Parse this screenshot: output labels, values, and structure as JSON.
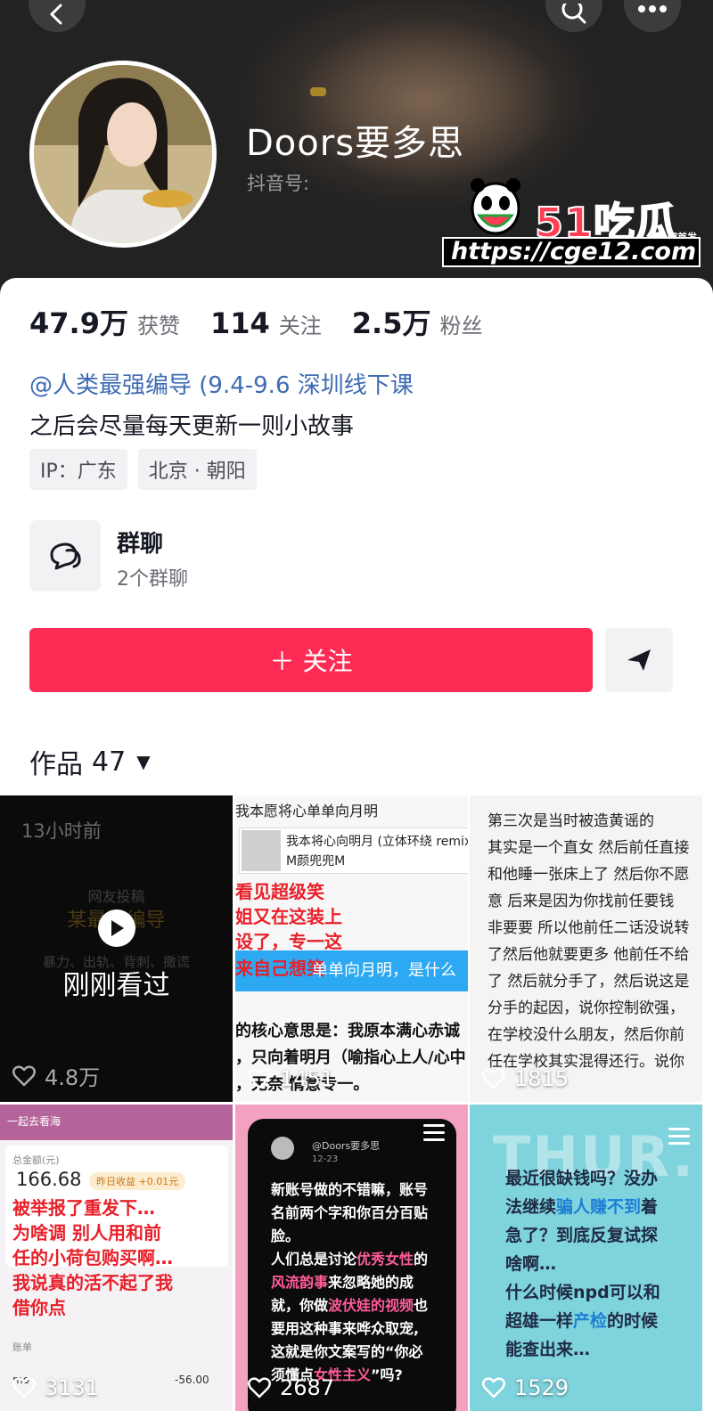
{
  "profile": {
    "nickname": "Doors要多思",
    "douyin_id_label": "抖音号:",
    "stats": [
      {
        "value": "47.9万",
        "label": "获赞"
      },
      {
        "value": "114",
        "label": "关注"
      },
      {
        "value": "2.5万",
        "label": "粉丝"
      }
    ],
    "bio_link": "@人类最强编导 (9.4-9.6 深圳线下课",
    "bio_text": "之后会尽量每天更新一则小故事",
    "tags": [
      "IP：广东",
      "北京 · 朝阳"
    ],
    "group_chat": {
      "title": "群聊",
      "subtitle": "2个群聊"
    },
    "follow_label": "＋ 关注"
  },
  "watermark": {
    "brand": "51吃瓜",
    "tag": "全网首发",
    "url": "https://cge12.com"
  },
  "works": {
    "label": "作品",
    "count": "47"
  },
  "videos": [
    {
      "likes": "4.8万",
      "time": "13小时前",
      "faint_top": "网友投稿",
      "faint_title": "某最强编导",
      "faint_sub": "暴力、出轨、背刺、撒谎",
      "watched": "刚刚看过"
    },
    {
      "likes": "1451",
      "top_caption": "我本愿将心单单向月明",
      "song_line1": "我本将心向明月 (立体环绕 remix",
      "song_line2": "M颜兜兜M",
      "red_lines": [
        "看见超级笑",
        "姐又在这装上",
        "设了，专一这",
        "来自己想笑"
      ],
      "blue_text": "单单向月明，是什么",
      "black_lines": [
        "的核心意思是：我原本满心赤诚",
        "，只向着明月（喻指心上人/心中",
        "，无奈     情意专一。"
      ]
    },
    {
      "likes": "1815",
      "lines": [
        "第三次是当时被造黄谣的",
        "其实是一个直女 然后前任直接",
        "和他睡一张床上了 然后你不愿",
        "意 后来是因为你找前任要钱",
        "非要要 所以他前任二话没说转",
        "了然后他就要更多 他前任不给",
        "了 然后就分手了，然后说这是",
        "分手的起因，说你控制欲强，",
        "在学校没什么朋友，然后你前",
        "任在学校其实混得还行。说你"
      ]
    },
    {
      "likes": "3131",
      "header": "一起去看海",
      "balance_label": "总金额(元)",
      "balance": "166.68",
      "pill": "昨日收益 +0.01元",
      "red_lines": [
        "被举报了重发下…",
        "为啥调 别人用和前",
        "任的小荷包购买啊…",
        "我说真的活不起了我",
        "借你点"
      ],
      "row_label": "账单",
      "payer": "mo",
      "amount": "-56.00"
    },
    {
      "likes": "2687",
      "account": "@Doors要多思",
      "date": "12-23",
      "lines": [
        {
          "pre": "新账号做的不错嘛，账号",
          "hl": "",
          "post": ""
        },
        {
          "pre": "名前两个字和你百分百贴",
          "hl": "",
          "post": ""
        },
        {
          "pre": "脸。",
          "hl": "",
          "post": ""
        },
        {
          "pre": "人们总是讨论",
          "hl": "优秀女性",
          "post": "的"
        },
        {
          "pre": "",
          "hl": "风流韵事",
          "post": "来忽略她的成"
        },
        {
          "pre": "就，你做",
          "hl": "波伏娃的视频",
          "post": "也"
        },
        {
          "pre": "要用这种事来哗众取宠,",
          "hl": "",
          "post": ""
        },
        {
          "pre": "这就是你文案写的“你必",
          "hl": "",
          "post": ""
        },
        {
          "pre": "须懂点",
          "hl": "女性主义",
          "post": "”吗?"
        }
      ]
    },
    {
      "likes": "1529",
      "big": "THUR.",
      "lines": [
        {
          "pre": "最近很缺钱吗？没办",
          "hl": "",
          "post": ""
        },
        {
          "pre": "法继续",
          "hl": "骗人赚不到",
          "post": "着"
        },
        {
          "pre": "急了？到底反复试探",
          "hl": "",
          "post": ""
        },
        {
          "pre": "啥啊…",
          "hl": "",
          "post": ""
        },
        {
          "pre": "什么时候npd可以和",
          "hl": "",
          "post": ""
        },
        {
          "pre": "超雄一样",
          "hl": "产检",
          "post": "的时候"
        },
        {
          "pre": "能查出来…",
          "hl": "",
          "post": ""
        }
      ]
    }
  ]
}
